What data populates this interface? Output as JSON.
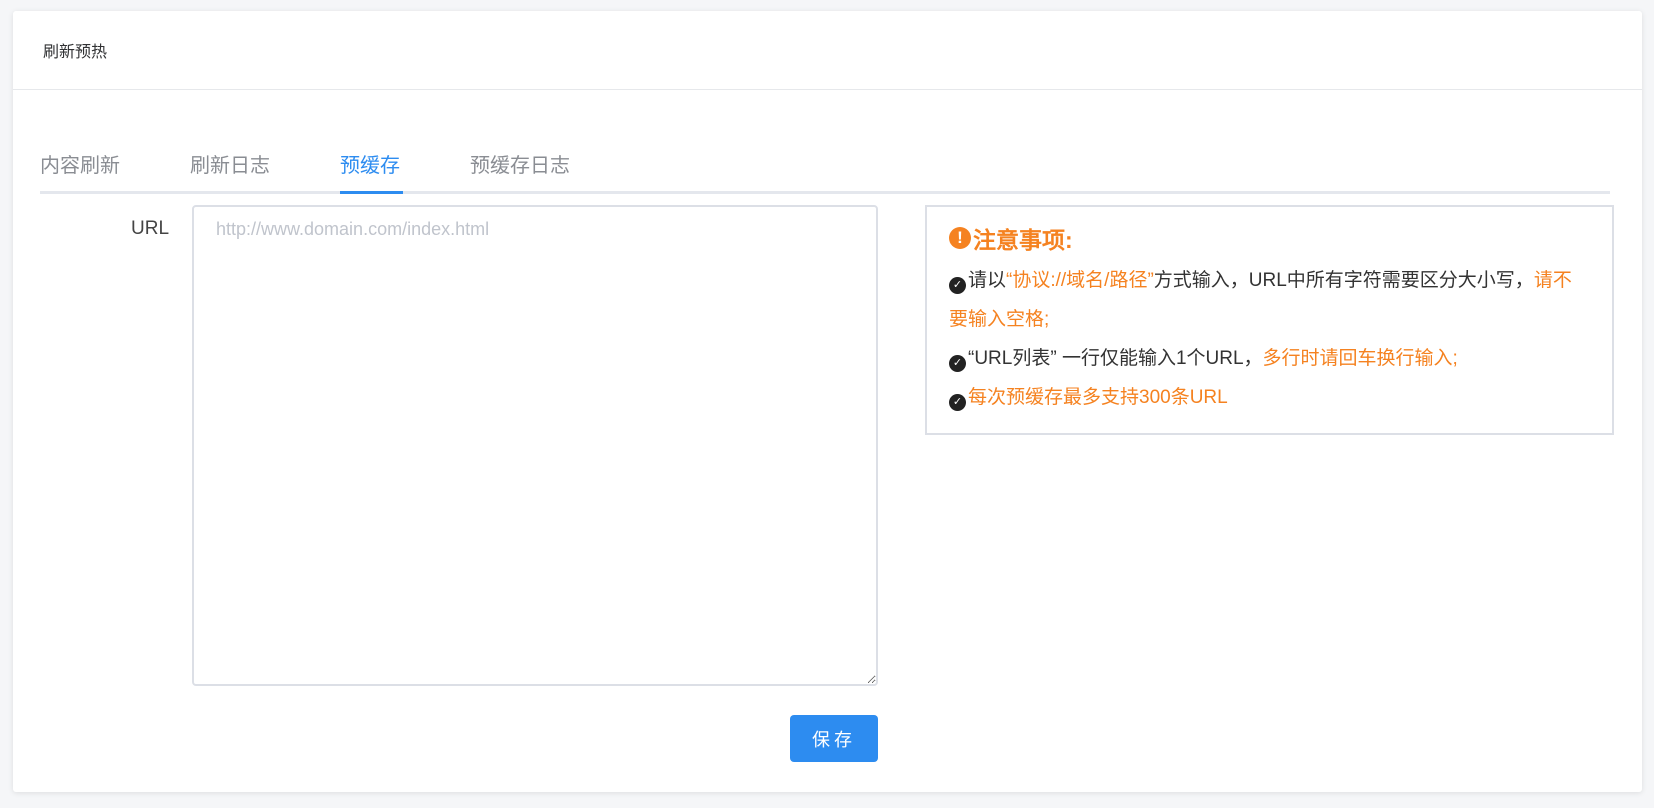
{
  "header": {
    "title": "刷新预热"
  },
  "tabs": [
    {
      "label": "内容刷新",
      "active": false
    },
    {
      "label": "刷新日志",
      "active": false
    },
    {
      "label": "预缓存",
      "active": true
    },
    {
      "label": "预缓存日志",
      "active": false
    }
  ],
  "form": {
    "url_label": "URL",
    "url_value": "",
    "url_placeholder": "http://www.domain.com/index.html",
    "save_label": "保存"
  },
  "notice": {
    "title": "注意事项:",
    "line1_a": "请以",
    "line1_b": "“协议://域名/路径”",
    "line1_c": "方式输入，URL中所有字符需要区分大小写，",
    "line1_d": "请不要输入空格;",
    "line2_a": "“URL列表” 一行仅能输入1个URL，",
    "line2_b": "多行时请回车换行输入;",
    "line3_a": "每次预缓存最多支持300条URL"
  },
  "colors": {
    "accent": "#2d8cf0",
    "warning": "#f58220"
  },
  "icons": {
    "warning": "exclamation-circle-icon",
    "check": "check-circle-icon"
  }
}
